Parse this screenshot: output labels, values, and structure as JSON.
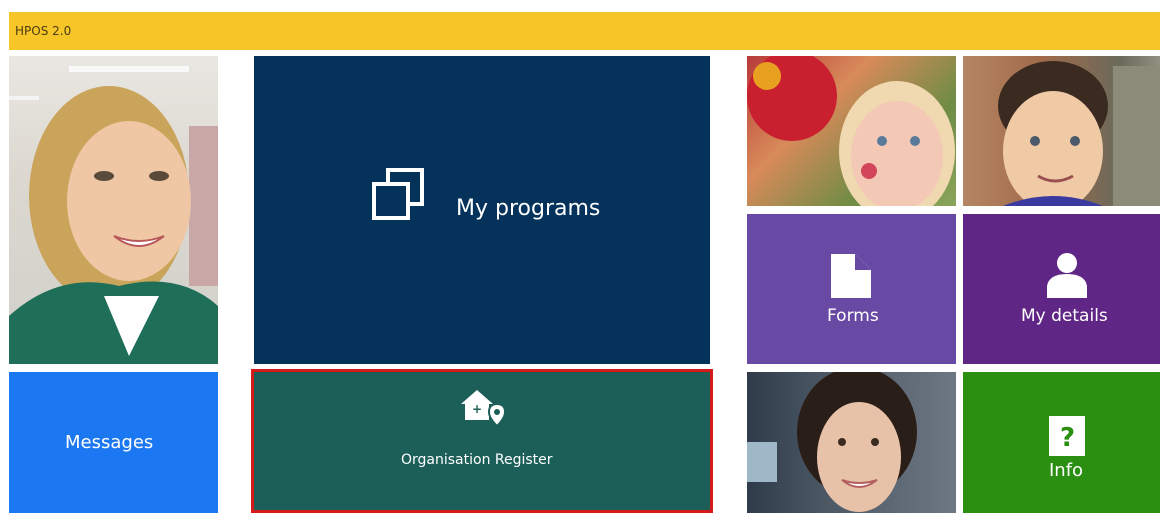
{
  "header": {
    "title": "HPOS 2.0",
    "color": "#f6c628"
  },
  "tiles": {
    "programs": {
      "label": "My programs",
      "icon": "copy-icon",
      "color": "#04325a"
    },
    "org_register": {
      "label": "Organisation Register",
      "icon": "home-location-icon",
      "color": "#1c5f59",
      "highlight": "#d51a1a"
    },
    "messages": {
      "label": "Messages",
      "color": "#1c78f2"
    },
    "forms": {
      "label": "Forms",
      "icon": "document-icon",
      "color": "#6849a4"
    },
    "details": {
      "label": "My details",
      "icon": "person-icon",
      "color": "#602686"
    },
    "info": {
      "label": "Info",
      "icon": "help-icon",
      "color": "#2b8f12"
    }
  }
}
